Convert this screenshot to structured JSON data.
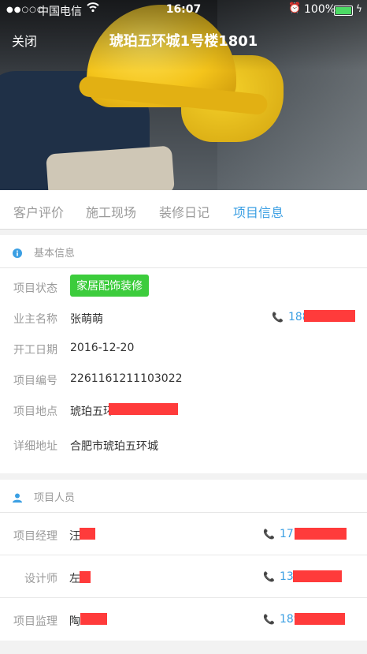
{
  "status_bar": {
    "signal": "●●○○○",
    "carrier": "中国电信",
    "time": "16:07",
    "battery": "100%"
  },
  "nav": {
    "close": "关闭",
    "title": "琥珀五环城1号楼1801"
  },
  "tabs": [
    {
      "label": "客户评价",
      "active": false
    },
    {
      "label": "施工现场",
      "active": false
    },
    {
      "label": "装修日记",
      "active": false
    },
    {
      "label": "项目信息",
      "active": true
    }
  ],
  "basic_info": {
    "title": "基本信息",
    "status_label": "项目状态",
    "status_value": "家居配饰装修",
    "owner_label": "业主名称",
    "owner_value": "张萌萌",
    "owner_phone": "188",
    "start_label": "开工日期",
    "start_value": "2016-12-20",
    "code_label": "项目编号",
    "code_value": "2261161211103022",
    "location_label": "项目地点",
    "location_value": "琥珀五环",
    "address_label": "详细地址",
    "address_value": "合肥市琥珀五环城"
  },
  "staff": {
    "title": "项目人员",
    "members": [
      {
        "role": "项目经理",
        "name": "汪",
        "phone": "177"
      },
      {
        "role": "设计师",
        "name": "左",
        "phone": "139"
      },
      {
        "role": "项目监理",
        "name": "陶",
        "phone": "189"
      }
    ]
  },
  "colors": {
    "accent": "#3b9fe3",
    "status_tag": "#3ccc3c",
    "redaction": "#ff3b3b"
  }
}
